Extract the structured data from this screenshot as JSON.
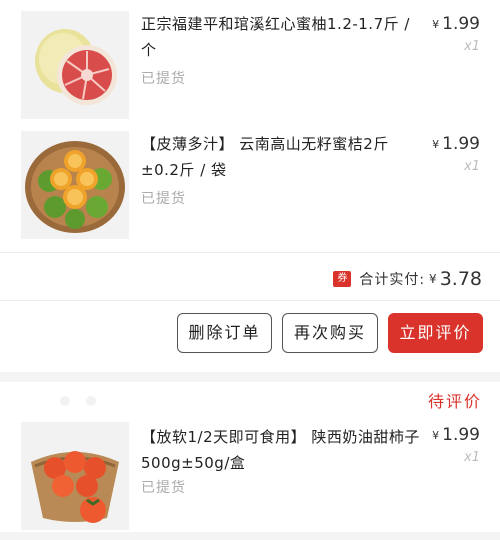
{
  "order_1": {
    "items": [
      {
        "title": "正宗福建平和琯溪红心蜜柚1.2-1.7斤 / 个",
        "status": "已提货",
        "currency": "¥",
        "price": "1.99",
        "qty": "x1",
        "thumb_icon": "pomelo-image"
      },
      {
        "title": "【皮薄多汁】 云南高山无籽蜜桔2斤 ±0.2斤 / 袋",
        "status": "已提货",
        "currency": "¥",
        "price": "1.99",
        "qty": "x1",
        "thumb_icon": "tangerine-basket-image"
      }
    ],
    "summary": {
      "coupon_badge": "券",
      "label": "合计实付:",
      "currency": "¥",
      "value": "3.78"
    },
    "actions": {
      "delete": "删除订单",
      "rebuy": "再次购买",
      "review": "立即评价"
    }
  },
  "order_2": {
    "status_label": "待评价",
    "items": [
      {
        "title": "【放软1/2天即可食用】 陕西奶油甜柿子500g±50g/盒",
        "status": "已提货",
        "currency": "¥",
        "price": "1.99",
        "qty": "x1",
        "thumb_icon": "persimmon-basket-image"
      }
    ]
  },
  "colors": {
    "accent": "#d9332b",
    "muted_text": "#aaaaaa",
    "background": "#f4f4f4"
  }
}
